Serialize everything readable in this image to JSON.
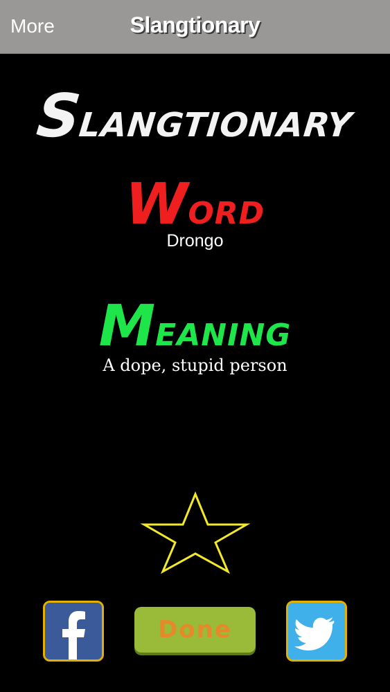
{
  "navbar": {
    "more_label": "More",
    "title": "Slangtionary"
  },
  "logo": {
    "first_letter": "S",
    "rest": "LANGTIONARY"
  },
  "word_section": {
    "heading_first": "W",
    "heading_rest": "ORD",
    "value": "Drongo"
  },
  "meaning_section": {
    "heading_first": "M",
    "heading_rest": "EANING",
    "value": "A dope, stupid person"
  },
  "favorite": {
    "icon": "star-outline-icon",
    "stroke_color": "#f2e92a"
  },
  "footer": {
    "facebook_icon": "facebook-icon",
    "twitter_icon": "twitter-icon",
    "done_label": "Done"
  },
  "colors": {
    "background": "#000000",
    "navbar": "#9a9797",
    "word": "#f01f1f",
    "meaning": "#1ee64a",
    "done_bg": "#9aba3a",
    "done_text": "#e48a2a"
  }
}
